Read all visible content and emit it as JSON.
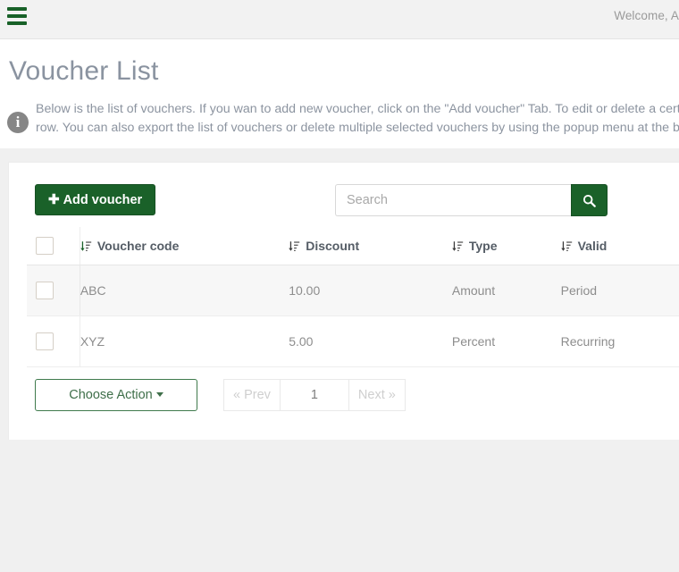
{
  "navbar": {
    "menu_icon": "hamburger-icon",
    "welcome_text": "Welcome, A"
  },
  "header": {
    "title": "Voucher List",
    "info_icon": "info-circle-icon",
    "description_line1": "Below is the list of vouchers. If you wan to add new voucher, click on the \"Add voucher\" Tab. To edit or delete a certain vo",
    "description_line2": "row. You can also export the list of vouchers or delete multiple selected vouchers by using the popup menu at the bottom"
  },
  "toolbar": {
    "add_label": "Add voucher",
    "add_icon": "plus-icon",
    "search_placeholder": "Search",
    "search_value": "",
    "search_icon": "search-icon"
  },
  "table": {
    "sort_icon": "sort-descending-icon",
    "select_all_checkbox": "checkbox-unchecked",
    "columns": [
      {
        "key": "code",
        "label": "Voucher code"
      },
      {
        "key": "disc",
        "label": "Discount"
      },
      {
        "key": "type",
        "label": "Type"
      },
      {
        "key": "valid",
        "label": "Valid"
      }
    ],
    "rows": [
      {
        "code": "ABC",
        "disc": "10.00",
        "type": "Amount",
        "valid": "Period"
      },
      {
        "code": "XYZ",
        "disc": "5.00",
        "type": "Percent",
        "valid": "Recurring"
      }
    ]
  },
  "footer": {
    "action_label": "Choose Action",
    "caret_icon": "caret-down-icon",
    "pagination": {
      "prev_label": "« Prev",
      "current_page": "1",
      "next_label": "Next »"
    }
  },
  "colors": {
    "brand_green": "#1a6129",
    "outline_green": "#3f7a4c",
    "title_gray": "#8a93a0",
    "page_bg": "#f0f0f0"
  }
}
